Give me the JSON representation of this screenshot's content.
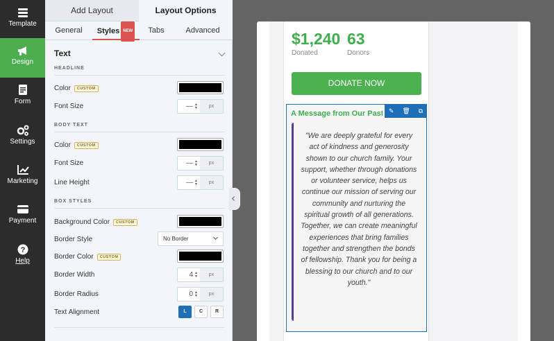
{
  "nav": {
    "items": [
      {
        "label": "Template",
        "icon": "template-icon",
        "active": false
      },
      {
        "label": "Design",
        "icon": "megaphone-icon",
        "active": true
      },
      {
        "label": "Form",
        "icon": "form-icon",
        "active": false
      },
      {
        "label": "Settings",
        "icon": "gears-icon",
        "active": false
      },
      {
        "label": "Marketing",
        "icon": "chart-icon",
        "active": false
      },
      {
        "label": "Payment",
        "icon": "card-icon",
        "active": false
      },
      {
        "label": "Help",
        "icon": "help-icon",
        "active": false
      }
    ]
  },
  "panel": {
    "tabs": [
      "Add Layout",
      "Layout Options"
    ],
    "subtabs": [
      "General",
      "Styles",
      "Tabs",
      "Advanced"
    ],
    "new_badge": "NEW",
    "section_title": "Text",
    "groups": {
      "headline": "HEADLINE",
      "body": "BODY TEXT",
      "box": "BOX STYLES"
    },
    "custom_badge": "CUSTOM",
    "labels": {
      "color": "Color",
      "font_size": "Font Size",
      "line_height": "Line Height",
      "background_color": "Background Color",
      "border_style": "Border Style",
      "border_color": "Border Color",
      "border_width": "Border Width",
      "border_radius": "Border Radius",
      "text_alignment": "Text Alignment"
    },
    "values": {
      "headline_font_size": "—",
      "body_font_size": "—",
      "line_height": "—",
      "border_style": "No Border",
      "border_width": "4",
      "border_radius": "0"
    },
    "unit": "px",
    "align": [
      "L",
      "C",
      "R"
    ],
    "colors": {
      "swatch": "#000000",
      "accent": "#4cae4f",
      "selected": "#1e6fb8"
    }
  },
  "preview": {
    "donated_amount": "$1,240",
    "donated_label": "Donated",
    "donors_count": "63",
    "donors_label": "Donors",
    "donate_button": "DONATE NOW",
    "message_title": "A Message from Our Pastor",
    "quote": "\"We are deeply grateful for every act of kindness and generosity shown to our church family. Your support, whether through donations or volunteer service, helps us continue our mission of serving our community and nurturing the spiritual growth of all generations. Together, we can create meaningful experiences that bring families together and strengthen the bonds of fellowship. Thank you for being a blessing to our church and to our youth.\""
  }
}
